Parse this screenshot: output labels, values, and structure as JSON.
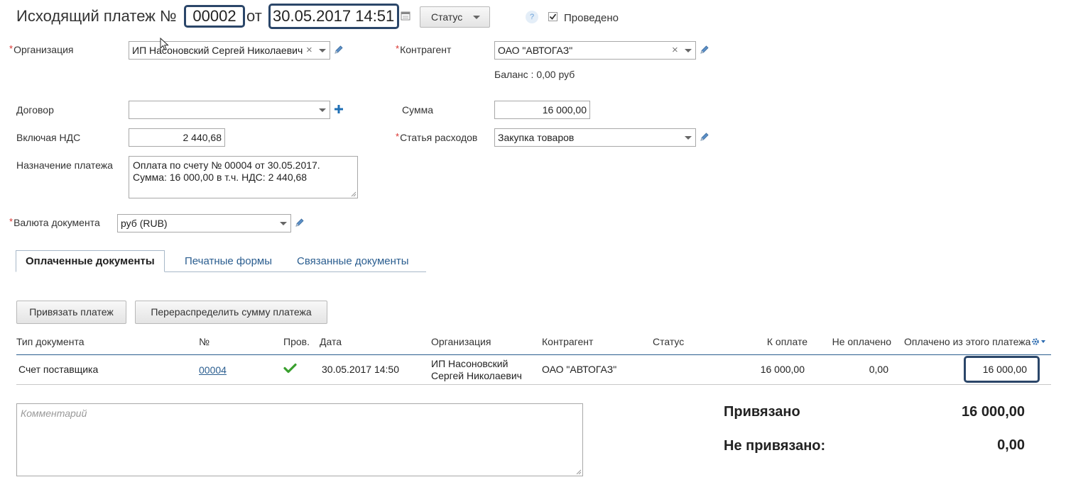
{
  "header": {
    "title": "Исходящий платеж №",
    "number": "00002",
    "from_word": "от",
    "datetime": "30.05.2017 14:51",
    "status_button": "Статус",
    "help": "?",
    "posted_label": "Проведено",
    "posted_checked": true
  },
  "form": {
    "organization": {
      "required": "*",
      "label": "Организация",
      "value": "ИП Насоновский Сергей Николаевич"
    },
    "contractor": {
      "required": "*",
      "label": "Контрагент",
      "value": "ОАО \"АВТОГАЗ\"",
      "balance": "Баланс : 0,00 руб"
    },
    "contract": {
      "label": "Договор",
      "value": ""
    },
    "sum": {
      "label": "Сумма",
      "value": "16 000,00"
    },
    "vat": {
      "label": "Включая НДС",
      "value": "2 440,68"
    },
    "expense": {
      "required": "*",
      "label": "Статья расходов",
      "value": "Закупка товаров"
    },
    "purpose": {
      "label": "Назначение платежа",
      "value": "Оплата по счету № 00004 от 30.05.2017.\nСумма: 16 000,00 в т.ч. НДС: 2 440,68"
    },
    "currency": {
      "required": "*",
      "label": "Валюта документа",
      "value": "руб (RUB)"
    }
  },
  "tabs": [
    {
      "label": "Оплаченные документы",
      "active": true
    },
    {
      "label": "Печатные формы",
      "active": false
    },
    {
      "label": "Связанные документы",
      "active": false
    }
  ],
  "toolbar": {
    "bind_payment": "Привязать платеж",
    "redistribute": "Перераспределить сумму платежа"
  },
  "table": {
    "headers": [
      "Тип документа",
      "№",
      "Пров.",
      "Дата",
      "Организация",
      "Контрагент",
      "Статус",
      "К оплате",
      "Не оплачено",
      "Оплачено из этого платежа"
    ],
    "rows": [
      {
        "type": "Счет поставщика",
        "number": "00004",
        "posted": true,
        "date": "30.05.2017 14:50",
        "org_line1": "ИП Насоновский",
        "org_line2": "Сергей Николаевич",
        "contractor": "ОАО \"АВТОГАЗ\"",
        "status": "",
        "to_pay": "16 000,00",
        "unpaid": "0,00",
        "paid_from_this": "16 000,00"
      }
    ]
  },
  "comment": {
    "placeholder": "Комментарий"
  },
  "totals": {
    "bound_label": "Привязано",
    "bound_value": "16 000,00",
    "unbound_label": "Не привязано:",
    "unbound_value": "0,00"
  },
  "colors": {
    "highlight_border": "#2b4669",
    "link": "#2a5d8f",
    "required": "#d9302c",
    "check_green": "#3aa02f",
    "add_blue": "#1f6fb5"
  }
}
